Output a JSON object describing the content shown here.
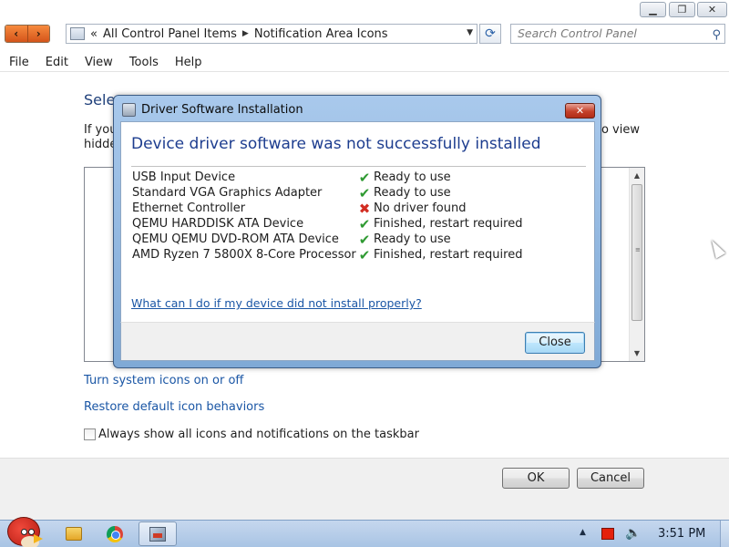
{
  "window": {
    "minimize_glyph": "▁",
    "maximize_glyph": "❐",
    "close_glyph": "✕"
  },
  "nav": {
    "back_glyph": "‹",
    "forward_glyph": "›"
  },
  "address": {
    "prefix_glyph": "«",
    "segments": [
      "All Control Panel Items",
      "Notification Area Icons"
    ],
    "separator_glyph": "▶",
    "dropdown_glyph": "▼",
    "refresh_glyph": "⟳"
  },
  "search": {
    "placeholder": "Search Control Panel",
    "icon": "search-icon"
  },
  "menu": [
    "File",
    "Edit",
    "View",
    "Tools",
    "Help"
  ],
  "main": {
    "heading_visible": "Selec",
    "desc_left": "If you",
    "desc_left_2": "hidde",
    "desc_right": "o view",
    "links": [
      "Turn system icons on or off",
      "Restore default icon behaviors"
    ],
    "checkbox_label": "Always show all icons and notifications on the taskbar",
    "ok_label": "OK",
    "cancel_label": "Cancel"
  },
  "dialog": {
    "title": "Driver Software Installation",
    "heading": "Device driver software was not successfully installed",
    "devices": [
      {
        "name": "USB Input Device",
        "status": "Ready to use",
        "state": "ok"
      },
      {
        "name": "Standard VGA Graphics Adapter",
        "status": "Ready to use",
        "state": "ok"
      },
      {
        "name": "Ethernet Controller",
        "status": "No driver found",
        "state": "error"
      },
      {
        "name": "QEMU HARDDISK ATA Device",
        "status": "Finished, restart required",
        "state": "ok"
      },
      {
        "name": "QEMU QEMU DVD-ROM ATA Device",
        "status": "Ready to use",
        "state": "ok"
      },
      {
        "name": "AMD Ryzen 7 5800X 8-Core Processor",
        "status": "Finished, restart required",
        "state": "ok"
      }
    ],
    "help_link": "What can I do if my device did not install properly?",
    "close_label": "Close",
    "ok_glyph": "✔",
    "error_glyph": "✖"
  },
  "taskbar": {
    "clock": "3:51 PM",
    "tray_arrow_glyph": "▲",
    "volume_glyph": "🔈"
  },
  "colors": {
    "accent_link": "#1a56a5",
    "dialog_heading": "#1d3d8f",
    "status_ok": "#2f9a32",
    "status_error": "#d22d22"
  }
}
